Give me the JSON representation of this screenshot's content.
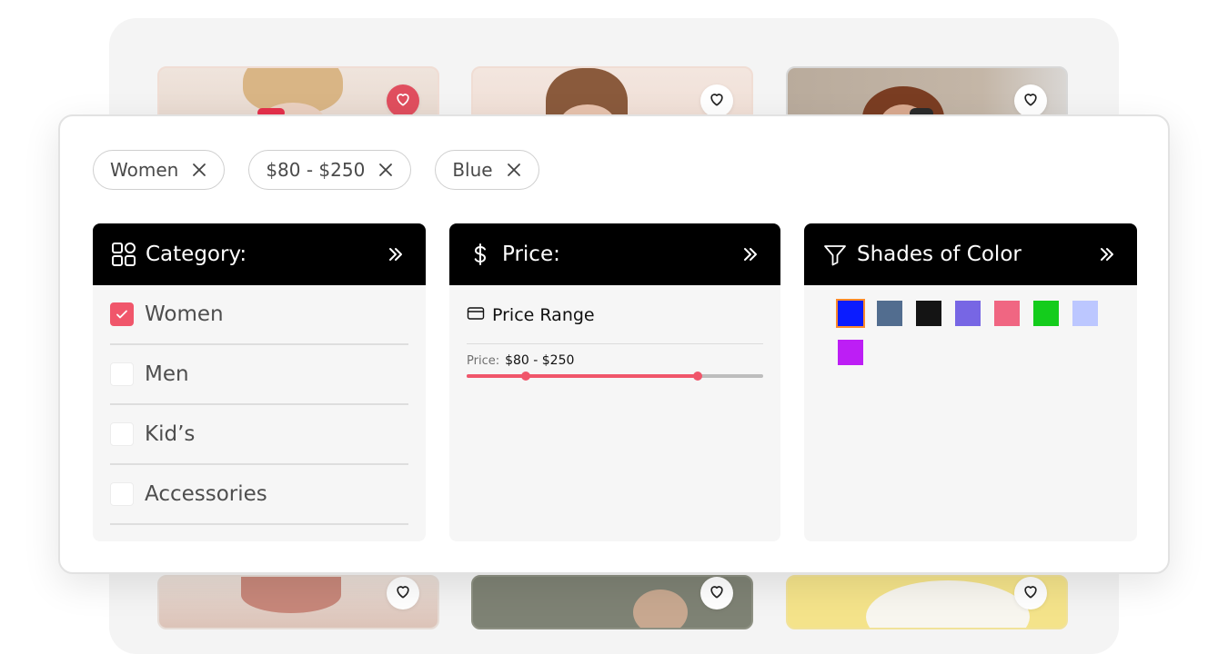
{
  "chips": [
    {
      "label": "Women"
    },
    {
      "label": "$80 - $250"
    },
    {
      "label": "Blue"
    }
  ],
  "category": {
    "title": "Category:",
    "items": [
      {
        "label": "Women",
        "checked": true
      },
      {
        "label": "Men",
        "checked": false
      },
      {
        "label": "Kid’s",
        "checked": false
      },
      {
        "label": "Accessories",
        "checked": false
      }
    ]
  },
  "price": {
    "title": "Price:",
    "range_title": "Price Range",
    "caption": "Price:",
    "value": "$80 - $250",
    "slider_low_fraction": 0.2,
    "slider_high_fraction": 0.78
  },
  "colors": {
    "title": "Shades of Color",
    "swatches": [
      "#0b1cff",
      "#526d8f",
      "#141414",
      "#7766e4",
      "#f06682",
      "#14cc1c",
      "#bcc7ff",
      "#bd1ef5"
    ],
    "selected_index": 0
  },
  "accent": "#f0566b",
  "products": [
    {
      "liked": true
    },
    {
      "liked": false
    },
    {
      "liked": false
    },
    {
      "liked": false
    },
    {
      "liked": false
    },
    {
      "liked": false
    }
  ]
}
